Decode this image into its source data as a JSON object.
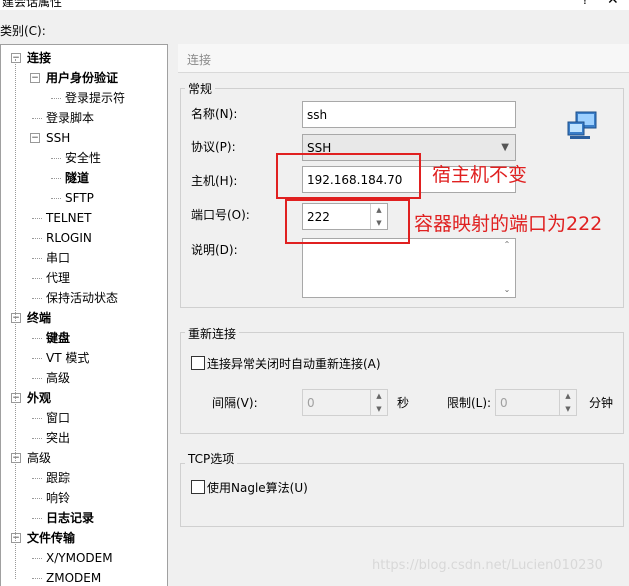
{
  "window": {
    "title": "建会话属性",
    "help": "?",
    "close": "✕"
  },
  "category_label": "类别(C):",
  "tree": [
    {
      "label": "连接",
      "bold": true,
      "level": 0,
      "expander": "−"
    },
    {
      "label": "用户身份验证",
      "bold": true,
      "level": 1,
      "expander": "−"
    },
    {
      "label": "登录提示符",
      "bold": false,
      "level": 2
    },
    {
      "label": "登录脚本",
      "bold": false,
      "level": 1
    },
    {
      "label": "SSH",
      "bold": false,
      "level": 1,
      "expander": "−"
    },
    {
      "label": "安全性",
      "bold": false,
      "level": 2
    },
    {
      "label": "隧道",
      "bold": true,
      "level": 2
    },
    {
      "label": "SFTP",
      "bold": false,
      "level": 2
    },
    {
      "label": "TELNET",
      "bold": false,
      "level": 1
    },
    {
      "label": "RLOGIN",
      "bold": false,
      "level": 1
    },
    {
      "label": "串口",
      "bold": false,
      "level": 1
    },
    {
      "label": "代理",
      "bold": false,
      "level": 1
    },
    {
      "label": "保持活动状态",
      "bold": false,
      "level": 1
    },
    {
      "label": "终端",
      "bold": true,
      "level": 0,
      "expander": "−"
    },
    {
      "label": "键盘",
      "bold": true,
      "level": 1
    },
    {
      "label": "VT 模式",
      "bold": false,
      "level": 1
    },
    {
      "label": "高级",
      "bold": false,
      "level": 1
    },
    {
      "label": "外观",
      "bold": true,
      "level": 0,
      "expander": "−"
    },
    {
      "label": "窗口",
      "bold": false,
      "level": 1
    },
    {
      "label": "突出",
      "bold": false,
      "level": 1
    },
    {
      "label": "高级",
      "bold": false,
      "level": 0,
      "expander": "−"
    },
    {
      "label": "跟踪",
      "bold": false,
      "level": 1
    },
    {
      "label": "响铃",
      "bold": false,
      "level": 1
    },
    {
      "label": "日志记录",
      "bold": true,
      "level": 1
    },
    {
      "label": "文件传输",
      "bold": true,
      "level": 0,
      "expander": "−"
    },
    {
      "label": "X/YMODEM",
      "bold": false,
      "level": 1
    },
    {
      "label": "ZMODEM",
      "bold": false,
      "level": 1
    }
  ],
  "breadcrumb": "连接",
  "general": {
    "title": "常规",
    "name_label": "名称(N):",
    "name_value": "ssh",
    "protocol_label": "协议(P):",
    "protocol_value": "SSH",
    "host_label": "主机(H):",
    "host_value": "192.168.184.70",
    "port_label": "端口号(O):",
    "port_value": "222",
    "desc_label": "说明(D):"
  },
  "reconnect": {
    "title": "重新连接",
    "auto_label": "连接异常关闭时自动重新连接(A)",
    "interval_label": "间隔(V):",
    "interval_value": "0",
    "interval_unit": "秒",
    "limit_label": "限制(L):",
    "limit_value": "0",
    "limit_unit": "分钟"
  },
  "tcp": {
    "title": "TCP选项",
    "nagle_label": "使用Nagle算法(U)"
  },
  "annotations": {
    "host_note": "宿主机不变",
    "port_note": "容器映射的端口为222"
  },
  "watermark": "https://blog.csdn.net/Lucien010230",
  "colors": {
    "annotation": "#e02020"
  }
}
